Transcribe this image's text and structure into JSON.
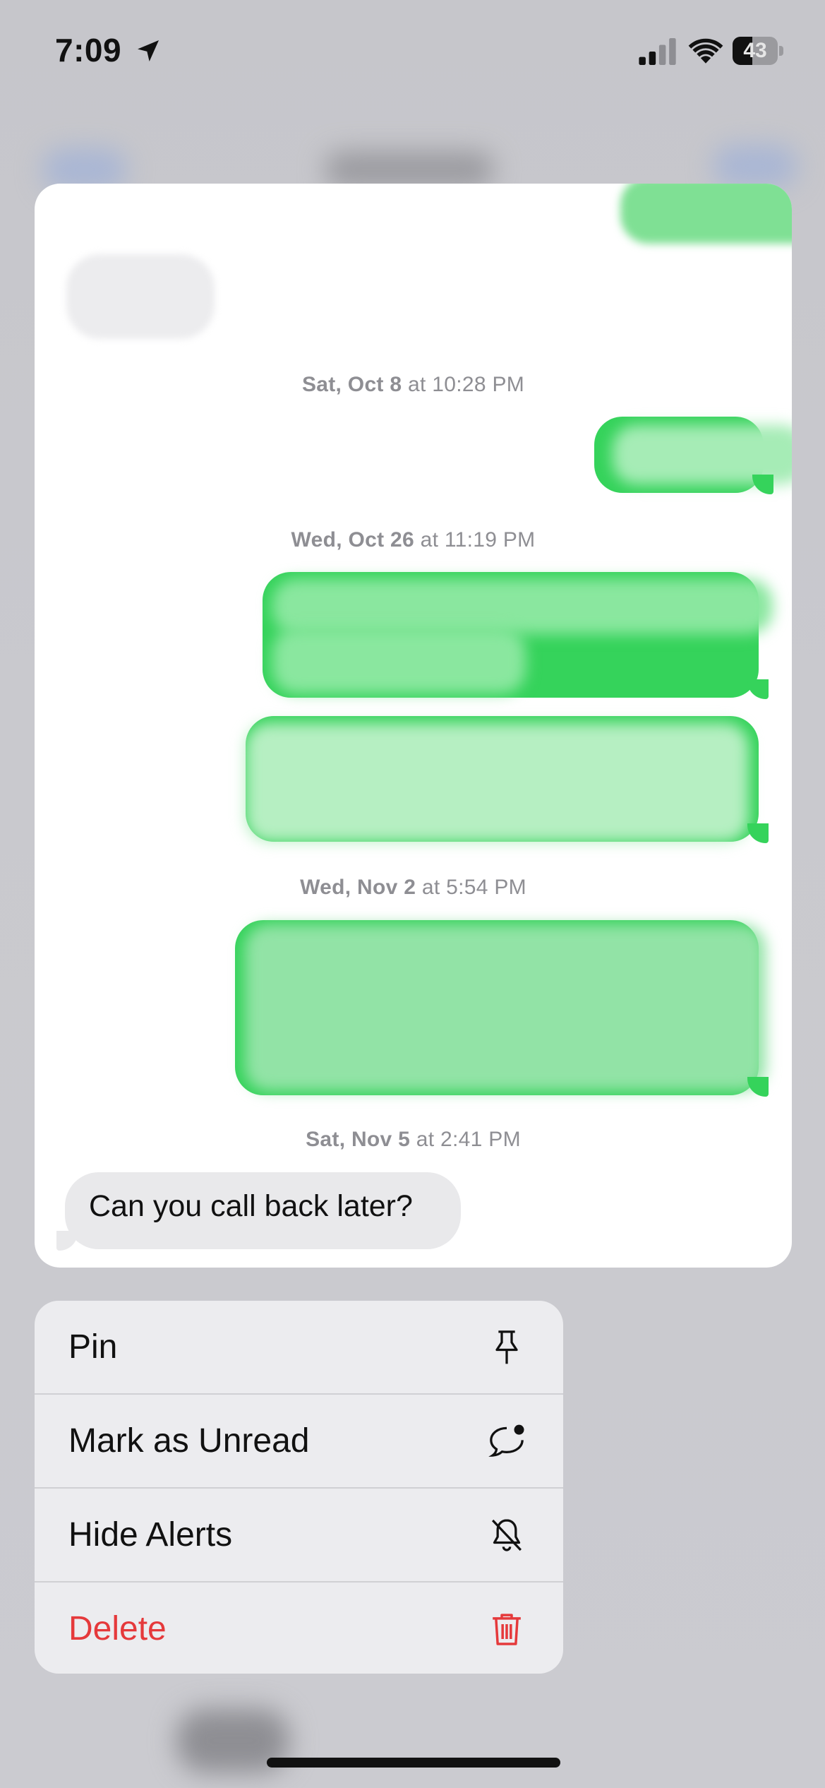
{
  "status_bar": {
    "time": "7:09",
    "battery_level": "43",
    "icons": [
      "location-arrow-icon",
      "cellular-signal-icon",
      "wifi-icon",
      "battery-icon"
    ]
  },
  "conversation": {
    "timestamps": [
      {
        "day": "Sat, Oct 8",
        "time": " at 10:28 PM"
      },
      {
        "day": "Wed, Oct 26",
        "time": " at 11:19 PM"
      },
      {
        "day": "Wed, Nov 2",
        "time": " at 5:54 PM"
      },
      {
        "day": "Sat, Nov 5",
        "time": " at 2:41 PM"
      }
    ],
    "last_incoming_message": "Can you call back later?"
  },
  "context_menu": {
    "items": [
      {
        "label": "Pin",
        "icon": "pin-icon"
      },
      {
        "label": "Mark as Unread",
        "icon": "unread-bubble-icon"
      },
      {
        "label": "Hide Alerts",
        "icon": "bell-slash-icon"
      },
      {
        "label": "Delete",
        "icon": "trash-icon"
      }
    ]
  },
  "colors": {
    "imessage_green": "#35d35b",
    "incoming_gray": "#e9e9eb",
    "destructive_red": "#e5393b",
    "timestamp_gray": "#8e8e93"
  }
}
